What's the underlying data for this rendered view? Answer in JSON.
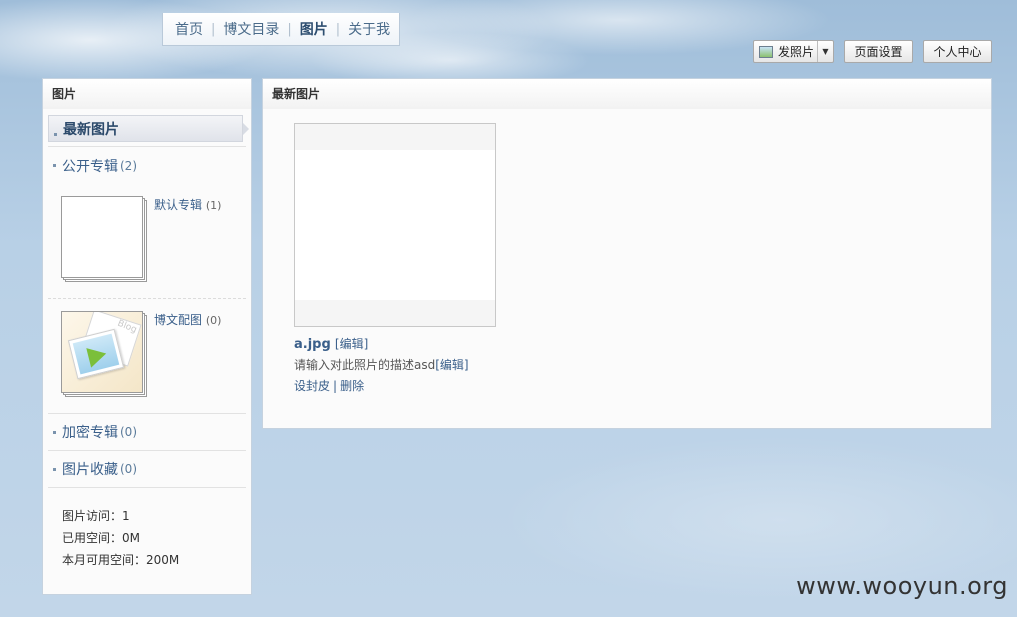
{
  "nav": {
    "items": [
      {
        "label": "首页",
        "active": false
      },
      {
        "label": "博文目录",
        "active": false
      },
      {
        "label": "图片",
        "active": true
      },
      {
        "label": "关于我",
        "active": false
      }
    ]
  },
  "toolbar": {
    "post_photo_label": "发照片",
    "page_settings_label": "页面设置",
    "personal_center_label": "个人中心"
  },
  "sidebar": {
    "title": "图片",
    "latest_label": "最新图片",
    "public_albums": {
      "label": "公开专辑",
      "count": "(2)"
    },
    "albums": [
      {
        "label": "默认专辑",
        "count": "(1)"
      },
      {
        "label": "博文配图",
        "count": "(0)",
        "thumb_text": "Blog"
      }
    ],
    "encrypted_albums": {
      "label": "加密专辑",
      "count": "(0)"
    },
    "favorites": {
      "label": "图片收藏",
      "count": "(0)"
    },
    "stats": {
      "visits": "图片访问：1",
      "used_space": "已用空间：0M",
      "available_space": "本月可用空间：200M"
    }
  },
  "main": {
    "title": "最新图片",
    "photo": {
      "filename": "a.jpg",
      "edit_label": "[编辑]",
      "description": "请输入对此照片的描述asd",
      "description_edit": "[编辑]",
      "set_cover": "设封皮",
      "separator": "|",
      "delete": "删除"
    }
  },
  "watermark": "www.wooyun.org",
  "colors": {
    "link": "#3a5f8a",
    "panel_border": "#c5d2df",
    "background": "#c7dbec"
  }
}
